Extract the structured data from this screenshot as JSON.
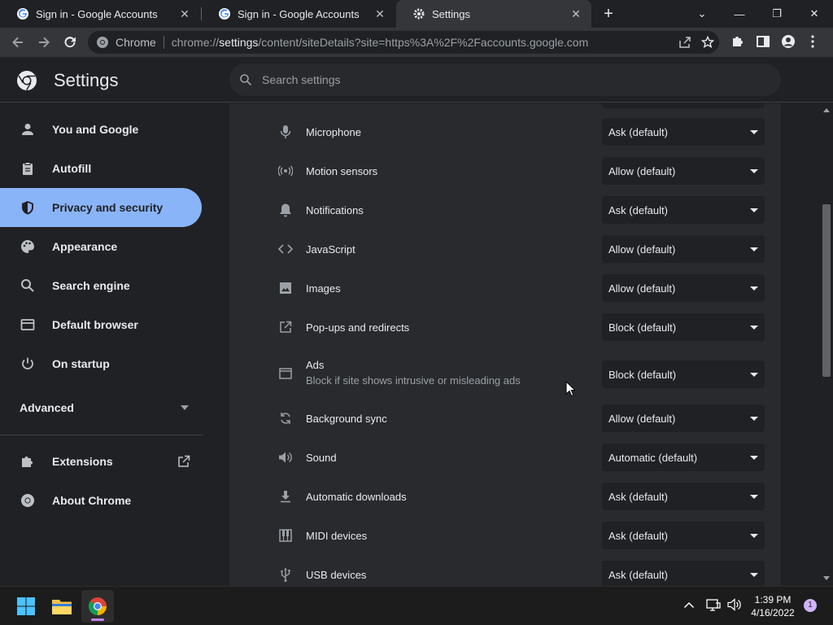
{
  "tabs": [
    {
      "label": "Sign in - Google Accounts",
      "close": "✕"
    },
    {
      "label": "Sign in - Google Accounts",
      "close": "✕"
    },
    {
      "label": "Settings",
      "close": "✕"
    }
  ],
  "new_tab": "+",
  "window_controls": {
    "menu": "⌄",
    "minimize": "—",
    "restore": "❐",
    "close": "✕"
  },
  "omnibox": {
    "site_label": "Chrome",
    "url_prefix": "chrome://",
    "url_host": "settings",
    "url_rest": "/content/siteDetails?site=https%3A%2F%2Faccounts.google.com"
  },
  "header": {
    "title": "Settings",
    "search_placeholder": "Search settings"
  },
  "sidebar": {
    "items": [
      {
        "label": "You and Google",
        "icon": "person-icon"
      },
      {
        "label": "Autofill",
        "icon": "clipboard-icon"
      },
      {
        "label": "Privacy and security",
        "icon": "shield-icon"
      },
      {
        "label": "Appearance",
        "icon": "palette-icon"
      },
      {
        "label": "Search engine",
        "icon": "search-icon"
      },
      {
        "label": "Default browser",
        "icon": "browser-icon"
      },
      {
        "label": "On startup",
        "icon": "power-icon"
      }
    ],
    "advanced": "Advanced",
    "extensions": "Extensions",
    "about": "About Chrome"
  },
  "permissions": [
    {
      "label": "Microphone",
      "value": "Ask (default)",
      "icon": "microphone-icon"
    },
    {
      "label": "Motion sensors",
      "value": "Allow (default)",
      "icon": "motion-sensors-icon"
    },
    {
      "label": "Notifications",
      "value": "Ask (default)",
      "icon": "bell-icon"
    },
    {
      "label": "JavaScript",
      "value": "Allow (default)",
      "icon": "code-icon"
    },
    {
      "label": "Images",
      "value": "Allow (default)",
      "icon": "image-icon"
    },
    {
      "label": "Pop-ups and redirects",
      "value": "Block (default)",
      "icon": "open-in-new-icon"
    },
    {
      "label": "Ads",
      "sub": "Block if site shows intrusive or misleading ads",
      "value": "Block (default)",
      "icon": "ads-icon"
    },
    {
      "label": "Background sync",
      "value": "Allow (default)",
      "icon": "sync-icon"
    },
    {
      "label": "Sound",
      "value": "Automatic (default)",
      "icon": "speaker-icon"
    },
    {
      "label": "Automatic downloads",
      "value": "Ask (default)",
      "icon": "download-icon"
    },
    {
      "label": "MIDI devices",
      "value": "Ask (default)",
      "icon": "piano-icon"
    },
    {
      "label": "USB devices",
      "value": "Ask (default)",
      "icon": "usb-icon"
    }
  ],
  "taskbar": {
    "time": "1:39 PM",
    "date": "4/16/2022",
    "notification_count": "1"
  },
  "colors": {
    "accent": "#8ab4f8",
    "background": "#202124",
    "content_bg": "#292a2d"
  }
}
